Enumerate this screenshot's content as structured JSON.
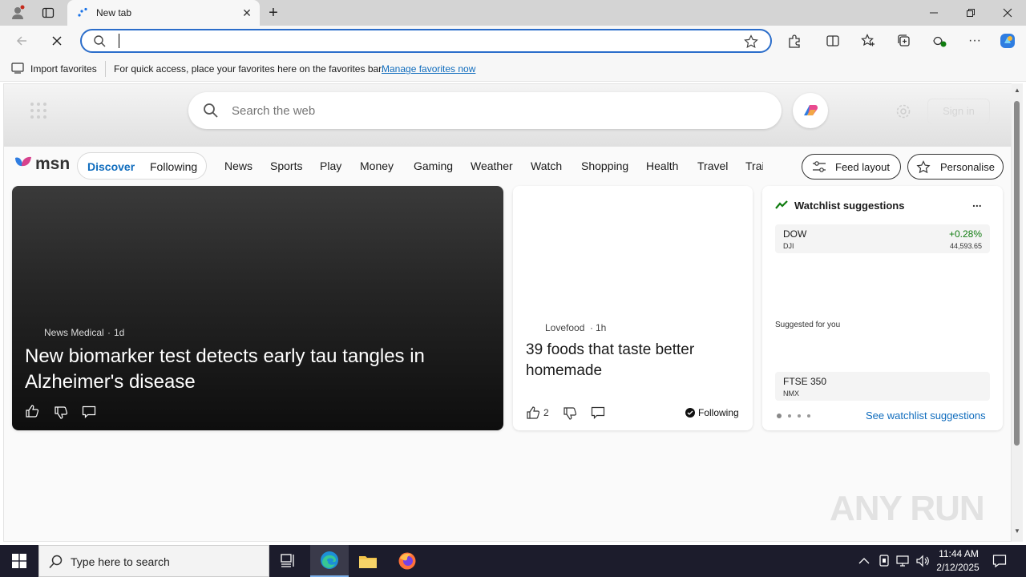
{
  "tab": {
    "title": "New tab"
  },
  "address": {
    "value": ""
  },
  "favorites_bar": {
    "import_label": "Import favorites",
    "hint": "For quick access, place your favorites here on the favorites bar.",
    "manage_link": "Manage favorites now"
  },
  "msn": {
    "search_placeholder": "Search the web",
    "sign_in": "Sign in",
    "logo": "msn",
    "pill": {
      "discover": "Discover",
      "following": "Following"
    },
    "nav": [
      "News",
      "Sports",
      "Play",
      "Money",
      "Gaming",
      "Weather",
      "Watch",
      "Shopping",
      "Health",
      "Travel",
      "Trai"
    ],
    "feed_layout": "Feed layout",
    "personalise": "Personalise"
  },
  "cards": {
    "main": {
      "source": "News Medical",
      "age": "1d",
      "headline": "New biomarker test detects early tau tangles in Alzheimer's disease"
    },
    "second": {
      "source": "Lovefood",
      "age": "1h",
      "headline": "39 foods that taste better homemade",
      "likes": "2",
      "following": "Following"
    },
    "watchlist": {
      "title": "Watchlist suggestions",
      "more": "...",
      "row1": {
        "symbol": "DOW",
        "sub": "DJI",
        "change": "+0.28%",
        "price": "44,593.65"
      },
      "suggested": "Suggested for you",
      "row2": {
        "symbol": "FTSE 350",
        "sub": "NMX"
      },
      "see_all": "See watchlist suggestions"
    }
  },
  "taskbar": {
    "search_placeholder": "Type here to search",
    "time": "11:44 AM",
    "date": "2/12/2025"
  },
  "watermark": "ANY RUN",
  "colors": {
    "accent": "#0f6cbd",
    "link": "#0f6cbd",
    "up": "#107c10",
    "taskbar": "#1c1c2c"
  }
}
